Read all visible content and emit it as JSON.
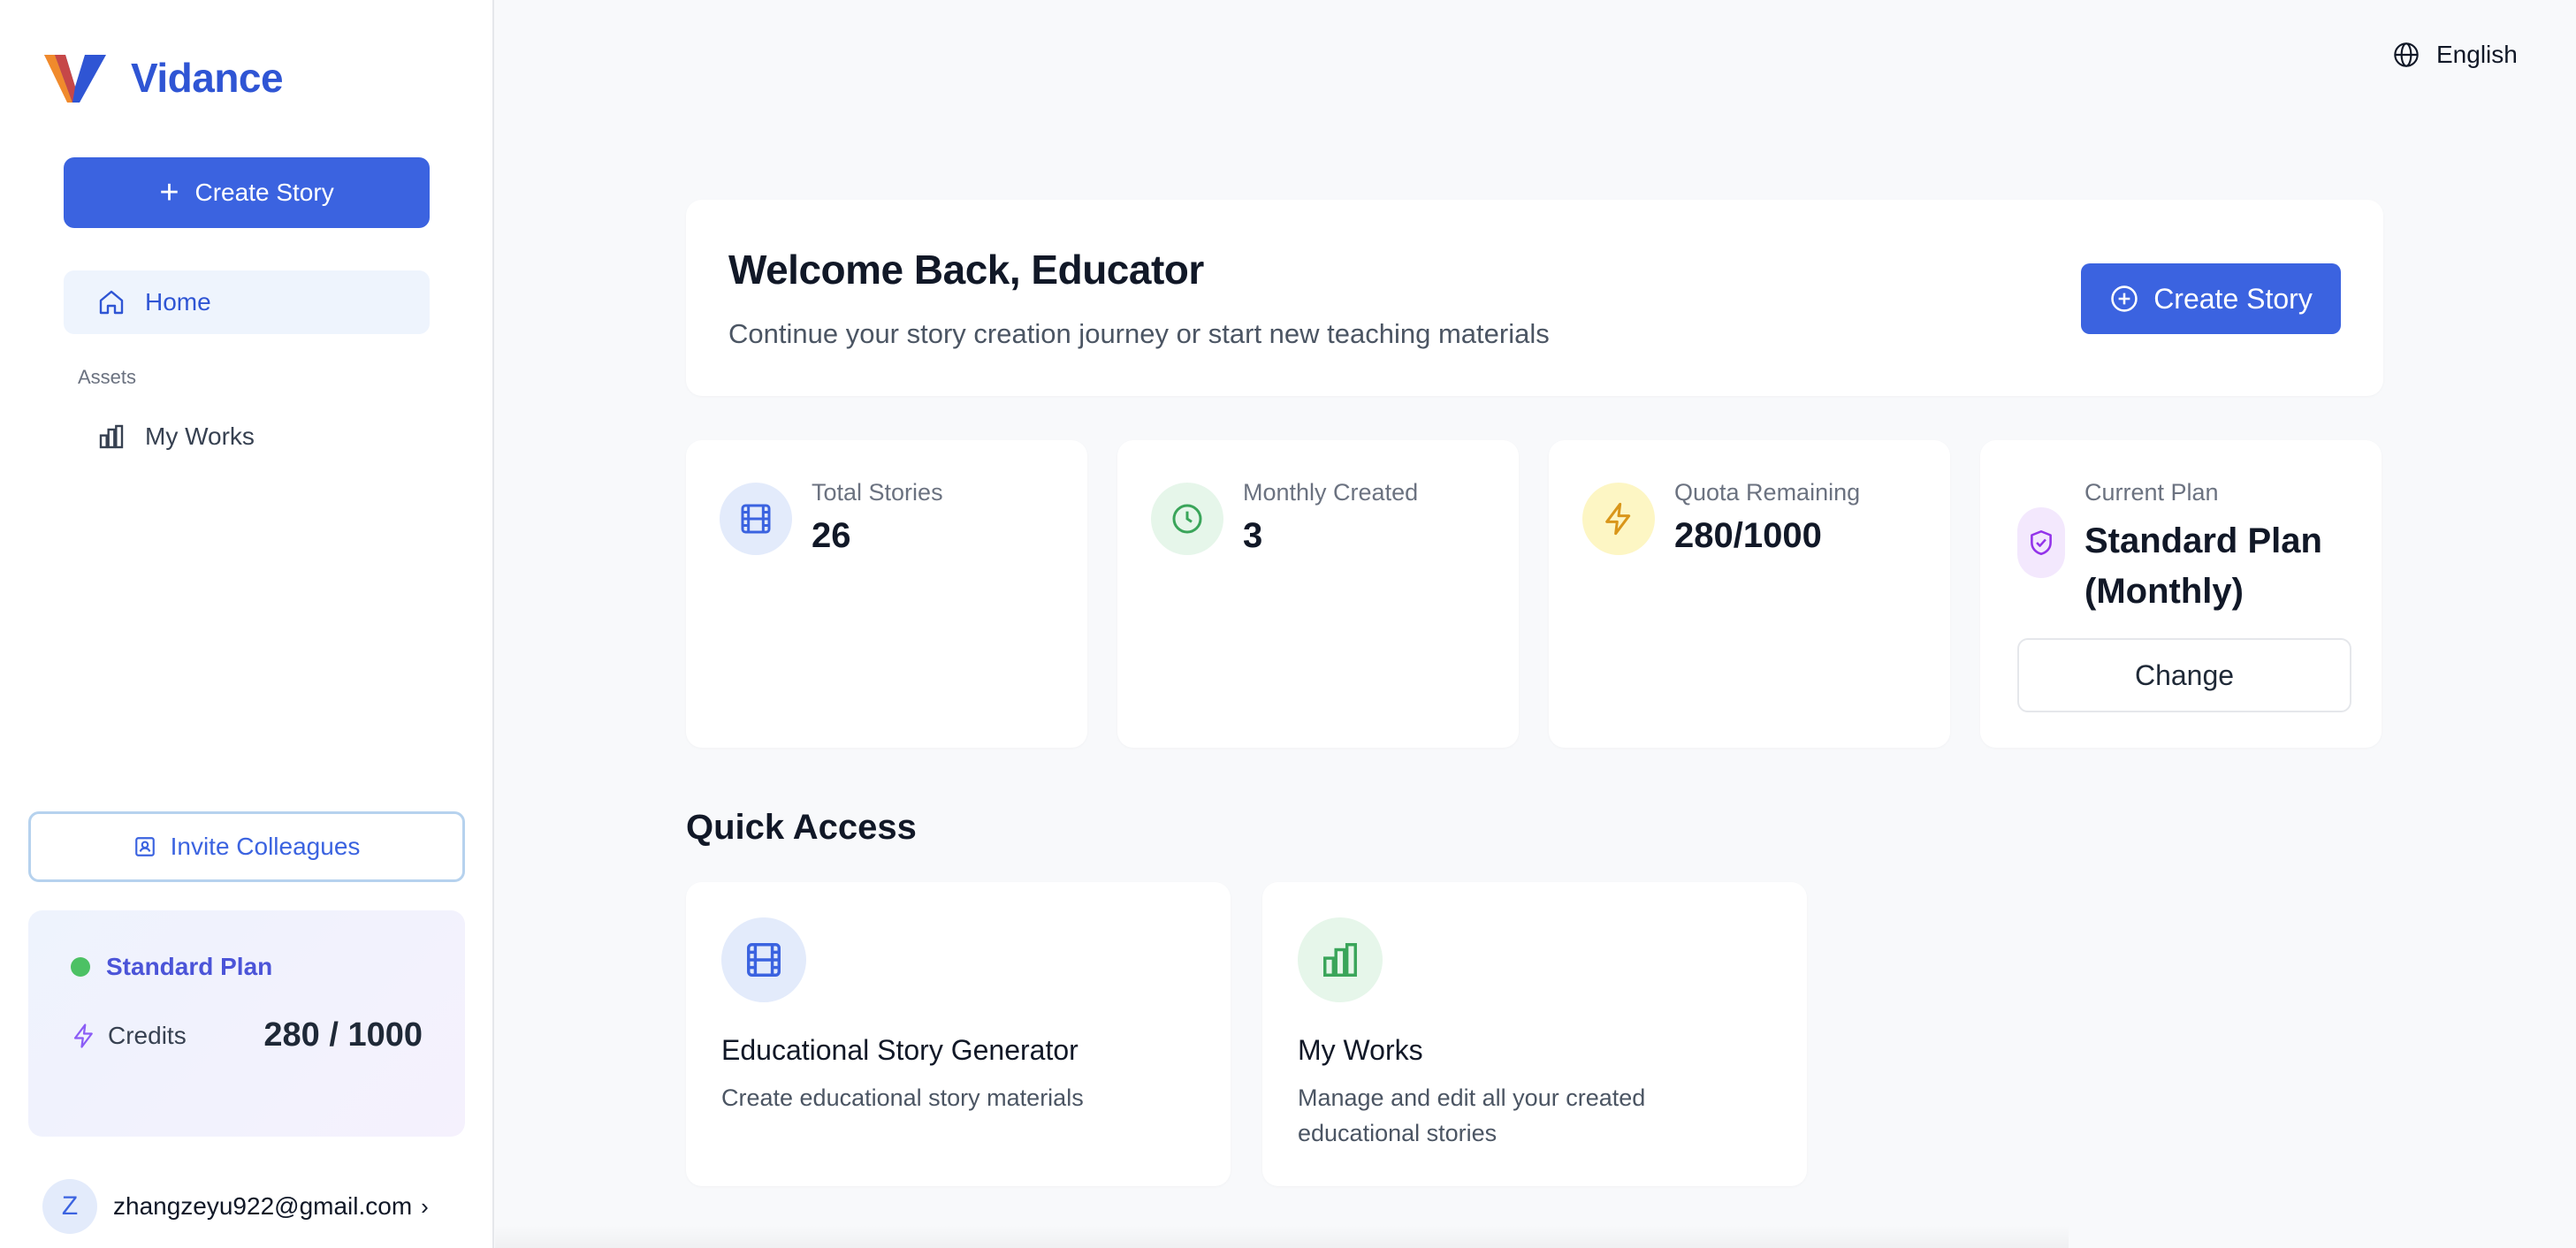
{
  "app": {
    "name": "Vidance"
  },
  "sidebar": {
    "create_label": "Create Story",
    "nav_home": "Home",
    "section_assets": "Assets",
    "nav_my_works": "My Works",
    "invite_label": "Invite Colleagues",
    "plan_name": "Standard Plan",
    "credits_label": "Credits",
    "credits_value": "280 / 1000",
    "user_initial": "Z",
    "user_email": "zhangzeyu922@gmail.com"
  },
  "header": {
    "language": "English"
  },
  "welcome": {
    "title": "Welcome Back, Educator",
    "subtitle": "Continue your story creation journey or start new teaching materials",
    "button_label": "Create Story"
  },
  "stats": [
    {
      "label": "Total Stories",
      "value": "26",
      "icon": "film-icon",
      "color": "#3b63e0"
    },
    {
      "label": "Monthly Created",
      "value": "3",
      "icon": "clock-icon",
      "color": "#3aa55a"
    },
    {
      "label": "Quota Remaining",
      "value": "280/1000",
      "icon": "lightning-icon",
      "color": "#d9961a"
    }
  ],
  "current_plan": {
    "label": "Current Plan",
    "value": "Standard Plan (Monthly)",
    "button_label": "Change",
    "icon": "shield-check-icon"
  },
  "quick_access": {
    "title": "Quick Access",
    "items": [
      {
        "title": "Educational Story Generator",
        "description": "Create educational story materials",
        "icon": "film-icon"
      },
      {
        "title": "My Works",
        "description": "Manage and edit all your created educational stories",
        "icon": "bar-chart-icon"
      }
    ]
  },
  "colors": {
    "primary": "#3b63e0",
    "brand_text": "#2f55d4",
    "plan_dot": "#4cc164",
    "plan_text": "#4b54d8"
  }
}
